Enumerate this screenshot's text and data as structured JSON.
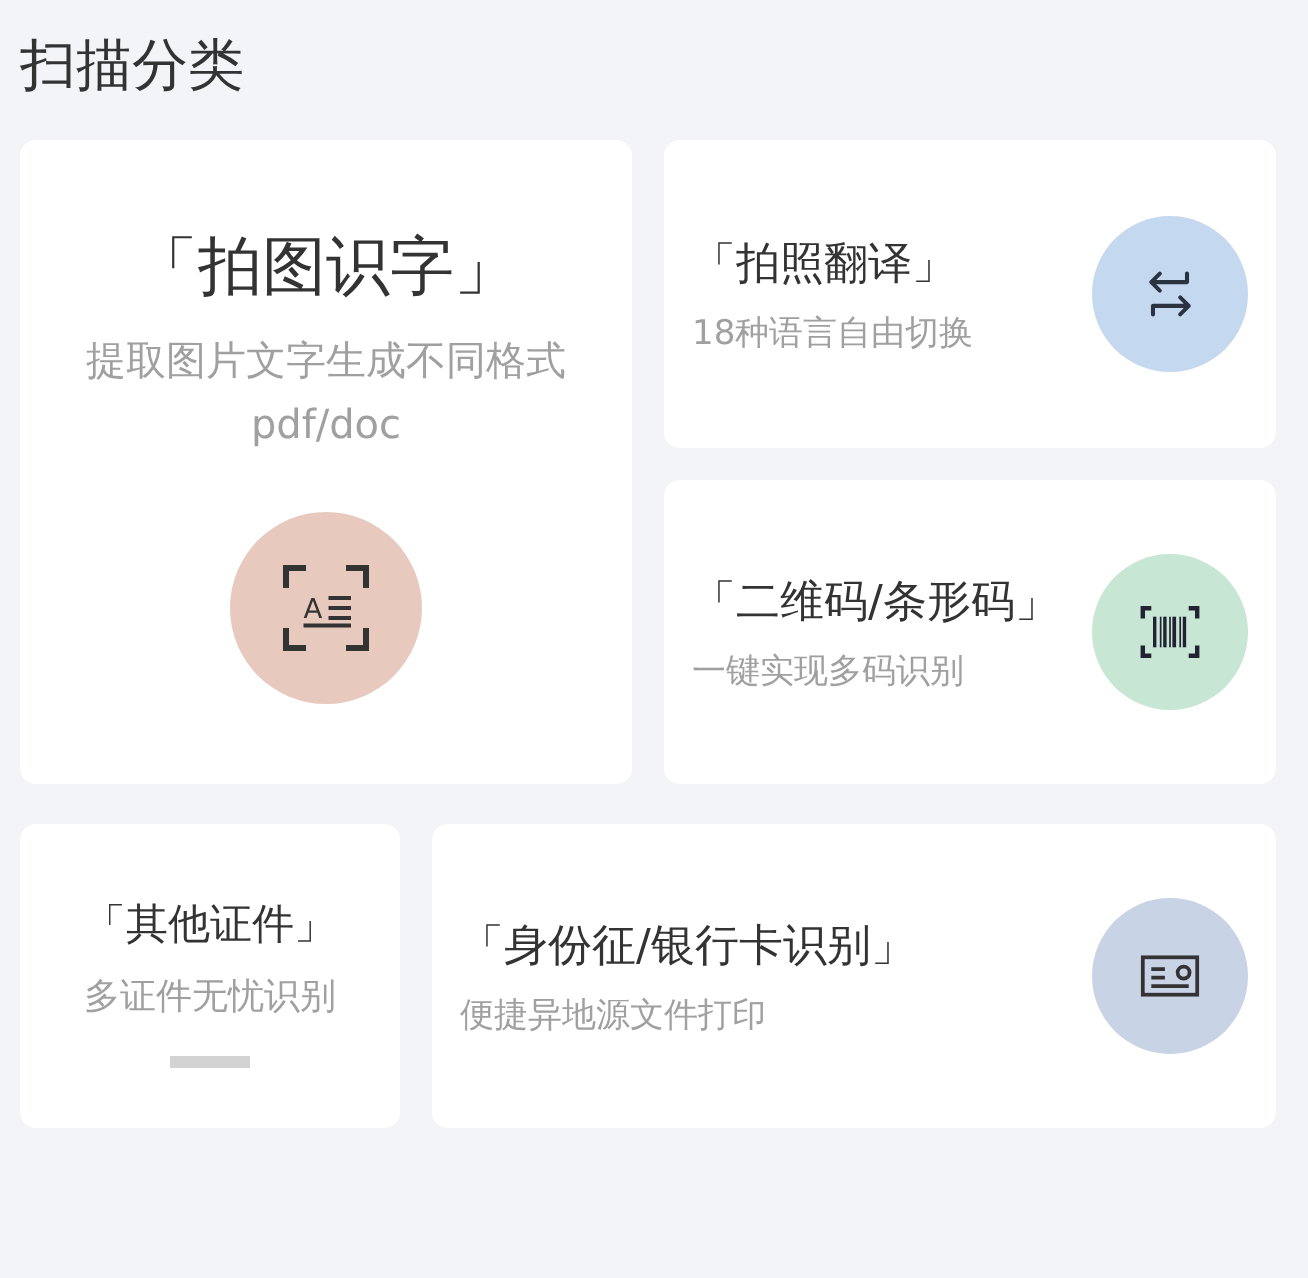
{
  "title": "扫描分类",
  "cards": [
    {
      "kind": "big",
      "title": "「拍图识字」",
      "subtitle": "提取图片文字生成不同格式",
      "subtitle_2": "pdf/doc",
      "icon_letter": "A",
      "color": "#e8c9bd"
    },
    {
      "kind": "side",
      "title": "「拍照翻译」",
      "subtitle": "18种语言自由切换",
      "color": "#c4d8f0"
    },
    {
      "kind": "side",
      "title": "「二维码/条形码」",
      "subtitle": "一键实现多码识别",
      "color": "#c8e6d4"
    },
    {
      "kind": "small",
      "title": "「其他证件」",
      "subtitle": "多证件无忧识别",
      "color": "#d3d3d3"
    },
    {
      "kind": "side",
      "title": "「身份征/银行卡识别」",
      "subtitle": "便捷异地源文件打印",
      "color": "#c9d3e6"
    }
  ]
}
